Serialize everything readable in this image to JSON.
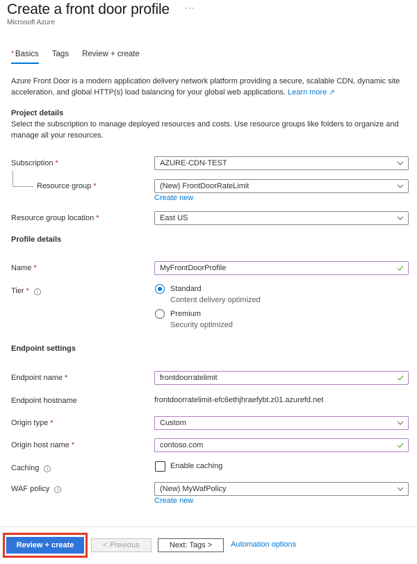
{
  "header": {
    "title": "Create a front door profile",
    "more_label": "···",
    "subtitle": "Microsoft Azure"
  },
  "tabs": [
    {
      "label": "Basics",
      "required": true,
      "active": true
    },
    {
      "label": "Tags",
      "required": false,
      "active": false
    },
    {
      "label": "Review + create",
      "required": false,
      "active": false
    }
  ],
  "intro": {
    "text": "Azure Front Door is a modern application delivery network platform providing a secure, scalable CDN, dynamic site acceleration, and global HTTP(s) load balancing for your global web applications.",
    "learn_more": "Learn more",
    "external_icon": "↗"
  },
  "project_details": {
    "title": "Project details",
    "description": "Select the subscription to manage deployed resources and costs. Use resource groups like folders to organize and manage all your resources.",
    "subscription": {
      "label": "Subscription",
      "value": "AZURE-CDN-TEST"
    },
    "resource_group": {
      "label": "Resource group",
      "value": "(New) FrontDoorRateLimit",
      "create_new": "Create new"
    },
    "location": {
      "label": "Resource group location",
      "value": "East US"
    }
  },
  "profile_details": {
    "title": "Profile details",
    "name": {
      "label": "Name",
      "value": "MyFrontDoorProfile"
    },
    "tier": {
      "label": "Tier",
      "options": [
        {
          "label": "Standard",
          "sub": "Content delivery optimized",
          "selected": true
        },
        {
          "label": "Premium",
          "sub": "Security optimized",
          "selected": false
        }
      ]
    }
  },
  "endpoint_settings": {
    "title": "Endpoint settings",
    "endpoint_name": {
      "label": "Endpoint name",
      "value": "frontdoorratelimit"
    },
    "endpoint_hostname": {
      "label": "Endpoint hostname",
      "value": "frontdoorratelimit-efc6ethjhraefybt.z01.azurefd.net"
    },
    "origin_type": {
      "label": "Origin type",
      "value": "Custom"
    },
    "origin_host_name": {
      "label": "Origin host name",
      "value": "contoso.com"
    },
    "caching": {
      "label": "Caching",
      "checkbox_label": "Enable caching",
      "checked": false
    },
    "waf_policy": {
      "label": "WAF policy",
      "value": "(New) MyWafPolicy",
      "create_new": "Create new"
    }
  },
  "footer": {
    "review_create": "Review + create",
    "previous": "< Previous",
    "next": "Next: Tags >",
    "automation": "Automation options"
  },
  "colors": {
    "accent": "#0078d4",
    "primary_button": "#2f74d8",
    "highlight_border": "#e23a22",
    "required_star": "#a4262c",
    "valid_border": "#b07fc7",
    "valid_check": "#57a300"
  }
}
